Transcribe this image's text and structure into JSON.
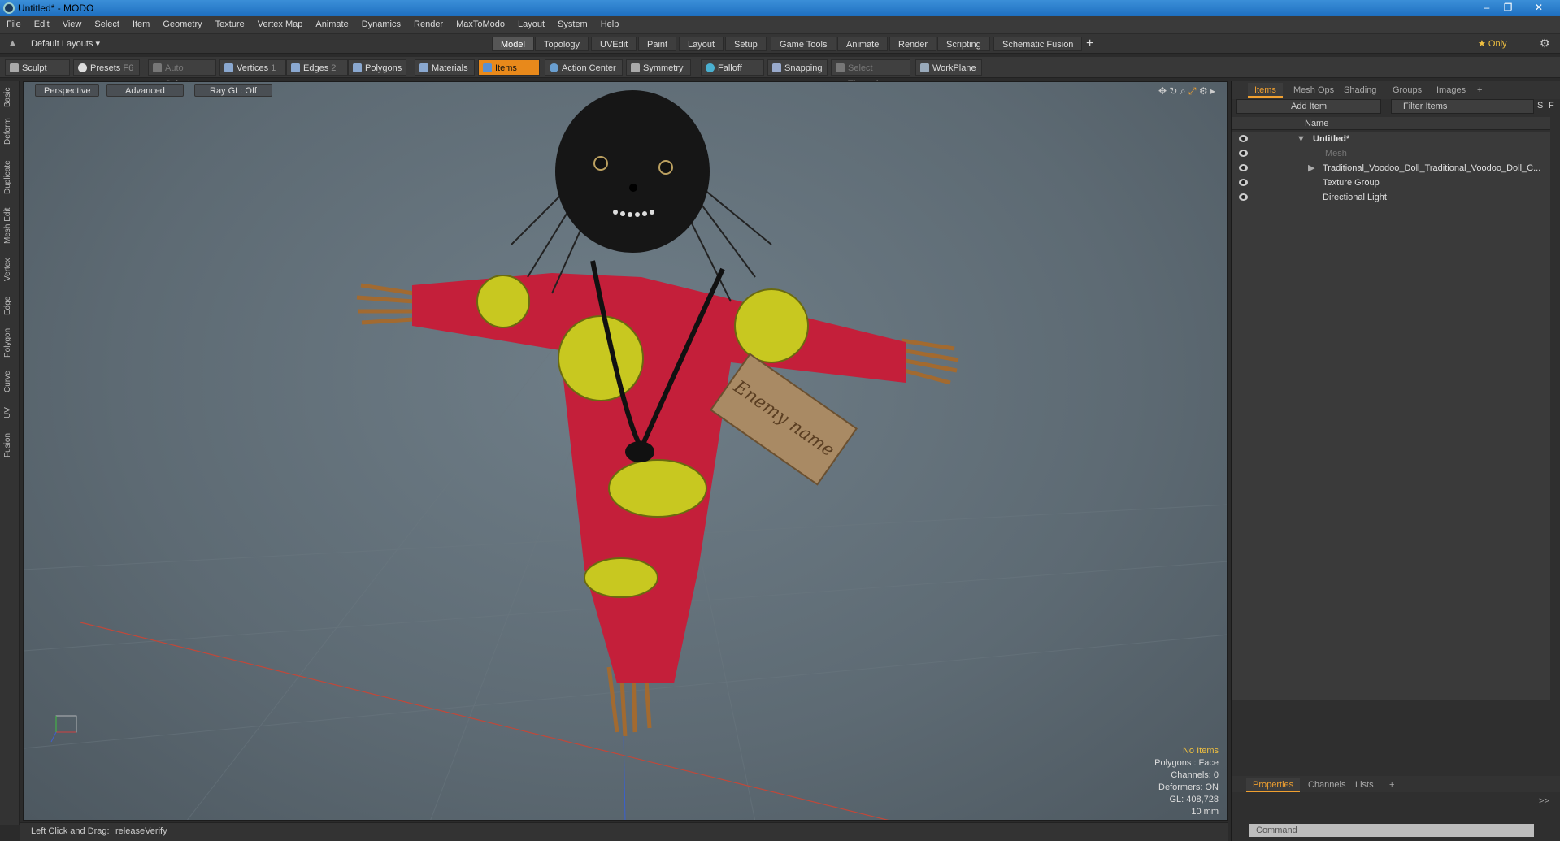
{
  "window": {
    "title": "Untitled* - MODO",
    "controls": [
      "–",
      "❐",
      "✕"
    ]
  },
  "menu": [
    "File",
    "Edit",
    "View",
    "Select",
    "Item",
    "Geometry",
    "Texture",
    "Vertex Map",
    "Animate",
    "Dynamics",
    "Render",
    "MaxToModo",
    "Layout",
    "System",
    "Help"
  ],
  "layoutbar": {
    "layouts_label": "Default Layouts ▾",
    "tabs": [
      "Model",
      "Topology",
      "UVEdit",
      "Paint",
      "Layout",
      "Setup",
      "Game Tools",
      "Animate",
      "Render",
      "Scripting",
      "Schematic Fusion"
    ],
    "active_tab": "Model",
    "add": "+",
    "only_label": "★ Only"
  },
  "toolbar": {
    "sculpt": "Sculpt",
    "presets": "Presets",
    "presets_key": "F6",
    "auto_select": "Auto Select",
    "vertices": "Vertices",
    "vertices_n": "1",
    "edges": "Edges",
    "edges_n": "2",
    "polygons": "Polygons",
    "materials": "Materials",
    "items": "Items",
    "action_center": "Action Center",
    "symmetry": "Symmetry",
    "falloff": "Falloff",
    "snapping": "Snapping",
    "select_through": "Select Through",
    "workplane": "WorkPlane"
  },
  "left_tabs": [
    "Basic",
    "Deform",
    "Duplicate",
    "Mesh Edit",
    "Vertex",
    "Edge",
    "Polygon",
    "Curve",
    "UV",
    "Fusion"
  ],
  "viewport": {
    "perspective": "Perspective",
    "advanced": "Advanced",
    "raygl": "Ray GL: Off",
    "tag_text": "Enemy name",
    "info": {
      "no_items": "No Items",
      "polygons": "Polygons : Face",
      "channels": "Channels: 0",
      "deformers": "Deformers: ON",
      "gl": "GL: 408,728",
      "scale": "10 mm"
    }
  },
  "status": {
    "left": "Left Click and Drag:",
    "action": "releaseVerify"
  },
  "items_panel": {
    "tabs": [
      "Items",
      "Mesh Ops",
      "Shading",
      "Groups",
      "Images",
      "+"
    ],
    "add_item": "Add Item",
    "filter": "Filter Items",
    "s": "S",
    "f": "F",
    "name_col": "Name",
    "rows": [
      {
        "label": "Untitled*"
      },
      {
        "label": "Mesh"
      },
      {
        "label": "Traditional_Voodoo_Doll_Traditional_Voodoo_Doll_C..."
      },
      {
        "label": "Texture Group"
      },
      {
        "label": "Directional Light"
      }
    ]
  },
  "properties_panel": {
    "tabs": [
      "Properties",
      "Channels",
      "Lists",
      "+"
    ],
    "command_placeholder": "Command",
    "expand": ">>"
  }
}
